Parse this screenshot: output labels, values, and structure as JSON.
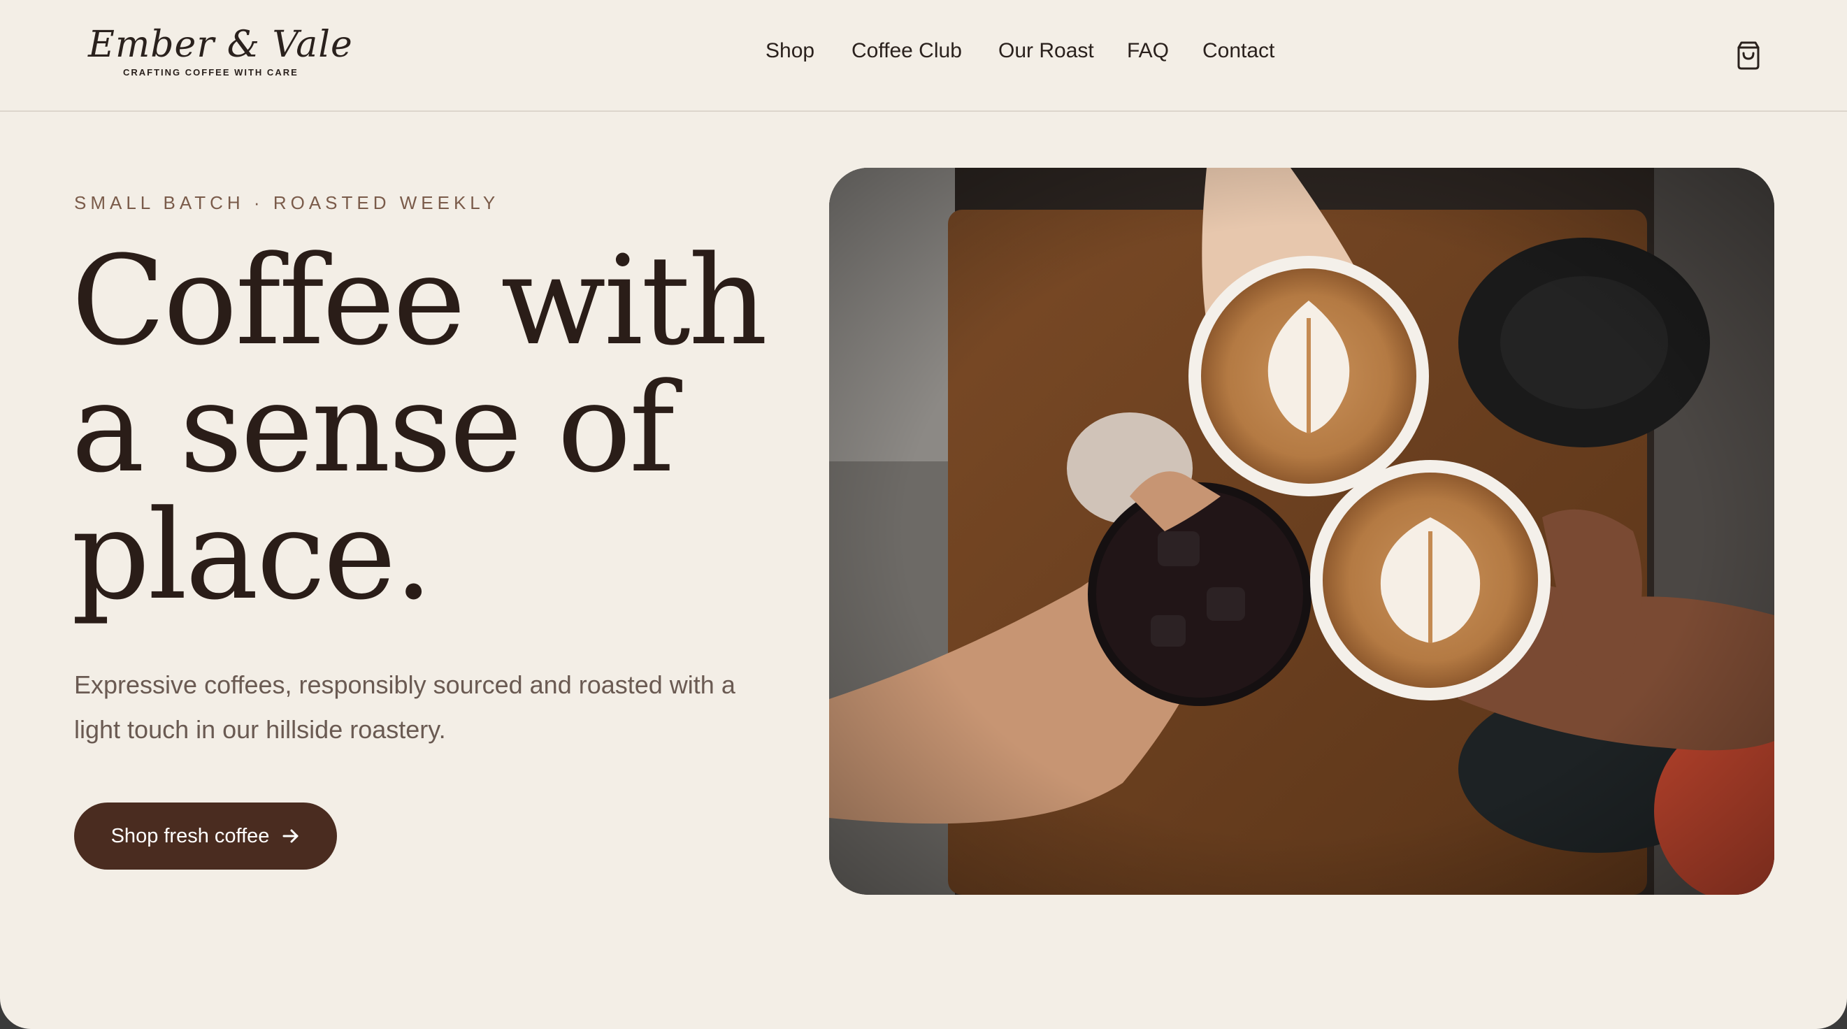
{
  "brand": {
    "name": "Ember & Vale",
    "tagline": "CRAFTING COFFEE WITH CARE"
  },
  "nav": {
    "items": [
      {
        "label": "Shop"
      },
      {
        "label": "Coffee Club"
      },
      {
        "label": "Our Roast"
      },
      {
        "label": "FAQ"
      },
      {
        "label": "Contact"
      }
    ],
    "cart_icon": "shopping-bag-icon"
  },
  "hero": {
    "eyebrow": "SMALL BATCH · ROASTED WEEKLY",
    "headline": "Coffee with a sense of place.",
    "subtext": "Expressive coffees, responsibly sourced and roasted with a light touch in our hillside roastery.",
    "cta_label": "Shop fresh coffee",
    "cta_icon": "arrow-right-icon"
  },
  "colors": {
    "background": "#f3eee6",
    "text": "#2a1d18",
    "accent": "#4a2c20",
    "eyebrow": "#7a5b4a"
  }
}
